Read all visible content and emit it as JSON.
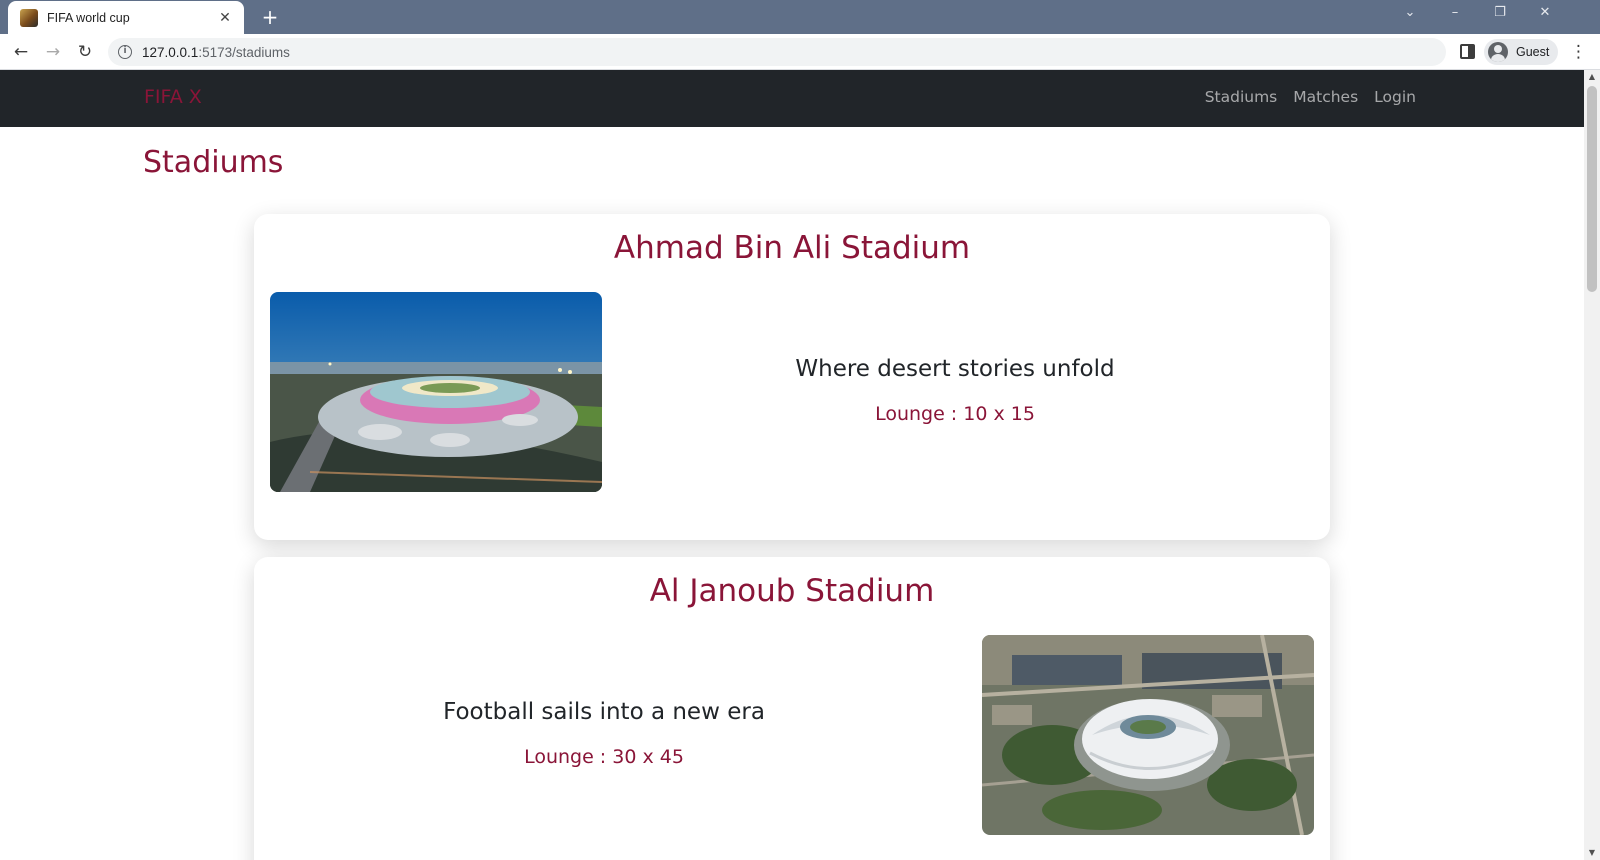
{
  "browser": {
    "tab_title": "FIFA world cup",
    "tab_close": "✕",
    "new_tab": "+",
    "url_host": "127.0.0.1",
    "url_rest": ":5173/stadiums",
    "profile_name": "Guest"
  },
  "site": {
    "brand": "FIFA X",
    "nav": [
      "Stadiums",
      "Matches",
      "Login"
    ]
  },
  "page": {
    "title": "Stadiums"
  },
  "stadiums": [
    {
      "name": "Ahmad Bin Ali Stadium",
      "slogan": "Where desert stories unfold",
      "lounge": "Lounge : 10 x 15",
      "image_position": "left"
    },
    {
      "name": "Al Janoub Stadium",
      "slogan": "Football sails into a new era",
      "lounge": "Lounge : 30 x 45",
      "image_position": "right"
    }
  ],
  "icons": {
    "back": "arrow-left-icon",
    "forward": "arrow-right-icon",
    "reload": "reload-icon",
    "info": "info-icon",
    "side_panel": "side-panel-icon",
    "profile": "profile-avatar-icon",
    "menu": "more-vert-icon"
  },
  "colors": {
    "brand": "#8a1538",
    "navbar": "#212529",
    "text": "#212529",
    "chrome_tabstrip": "#5f6f88"
  }
}
